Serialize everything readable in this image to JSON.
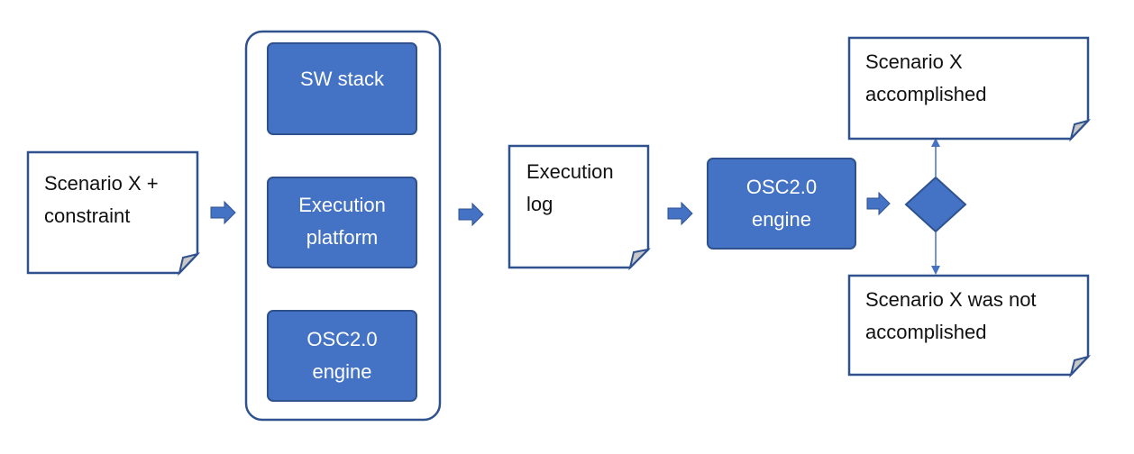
{
  "colors": {
    "process_fill": "#4472C4",
    "process_stroke": "#2F528F",
    "document_stroke": "#2F528F",
    "fold_fill": "#C8C8C8",
    "arrow_fill": "#4472C4",
    "connector": "#4472C4"
  },
  "nodes": {
    "input_doc": {
      "lines": [
        "Scenario X +",
        "constraint"
      ]
    },
    "sw_stack": {
      "lines": [
        "SW stack"
      ]
    },
    "execution_platform": {
      "lines": [
        "Execution",
        "platform"
      ]
    },
    "osc_engine_inner": {
      "lines": [
        "OSC2.0",
        "engine"
      ]
    },
    "execution_log": {
      "lines": [
        "Execution",
        "log"
      ]
    },
    "osc_engine": {
      "lines": [
        "OSC2.0",
        "engine"
      ]
    },
    "accomplished": {
      "lines": [
        "Scenario X",
        "accomplished"
      ]
    },
    "not_accomplished": {
      "lines": [
        "Scenario X was not",
        "accomplished"
      ]
    }
  }
}
